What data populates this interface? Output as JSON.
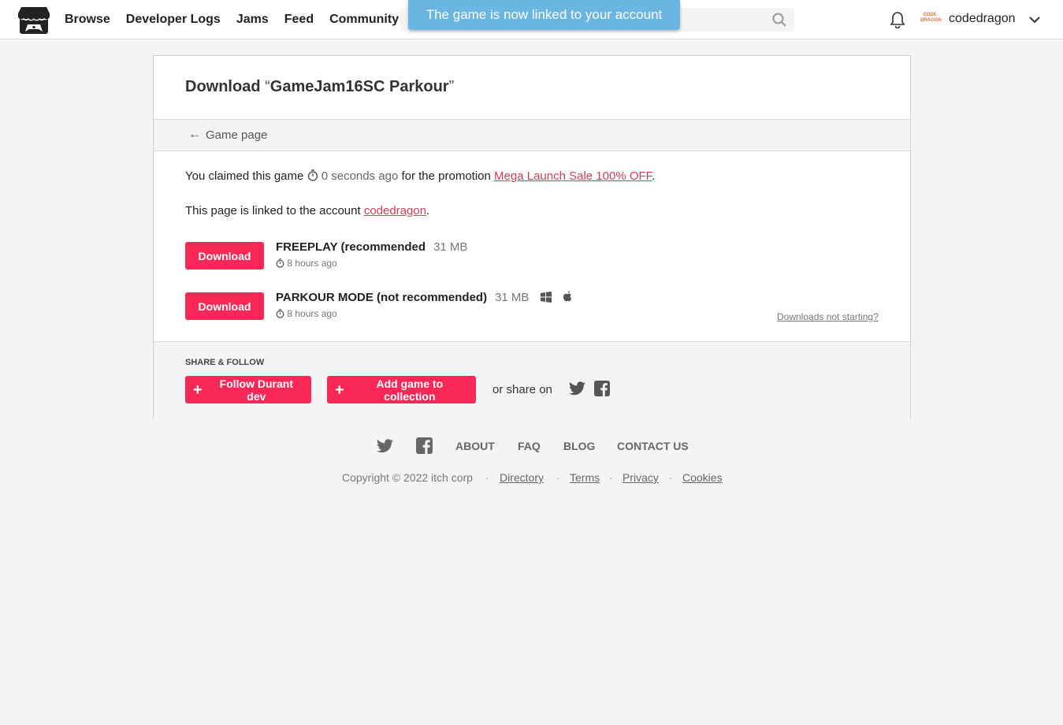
{
  "header": {
    "nav": [
      "Browse",
      "Developer Logs",
      "Jams",
      "Feed",
      "Community"
    ],
    "search_placeholder": "",
    "toast": "The game is now linked to your account",
    "avatar_text": "CODE DRAGON",
    "username": "codedragon"
  },
  "card": {
    "title_prefix": "Download ",
    "open_quote": "“",
    "game_name": "GameJam16SC Parkour",
    "close_quote": "”",
    "back_arrow": "←",
    "game_page_link": "Game page",
    "claim_text_1": "You claimed this game",
    "claim_time": "0 seconds ago",
    "claim_text_2": "for the promotion",
    "promotion_link": "Mega Launch Sale 100% OFF",
    "period": ".",
    "linked_text": "This page is linked to the account",
    "account_link": "codedragon",
    "downloads": [
      {
        "button": "Download",
        "name": "FREEPLAY (recommended",
        "size": "31 MB",
        "time": "8 hours ago"
      },
      {
        "button": "Download",
        "name": "PARKOUR MODE (not recommended)",
        "size": "31 MB",
        "time": "8 hours ago"
      }
    ],
    "not_starting": "Downloads not starting?",
    "share_heading": "SHARE & FOLLOW",
    "plus": "+",
    "follow_button": "Follow Durant dev",
    "collection_button": "Add game to collection",
    "share_on": "or share on"
  },
  "footer": {
    "links": [
      "ABOUT",
      "FAQ",
      "BLOG",
      "CONTACT US"
    ],
    "copyright": "Copyright © 2022 itch corp",
    "separator": "·",
    "bottom_links": [
      "Directory",
      "Terms",
      "Privacy",
      "Cookies"
    ]
  },
  "colors": {
    "accent": "#fa2857",
    "link": "#d63d56",
    "toast": "#6ab5e1"
  }
}
